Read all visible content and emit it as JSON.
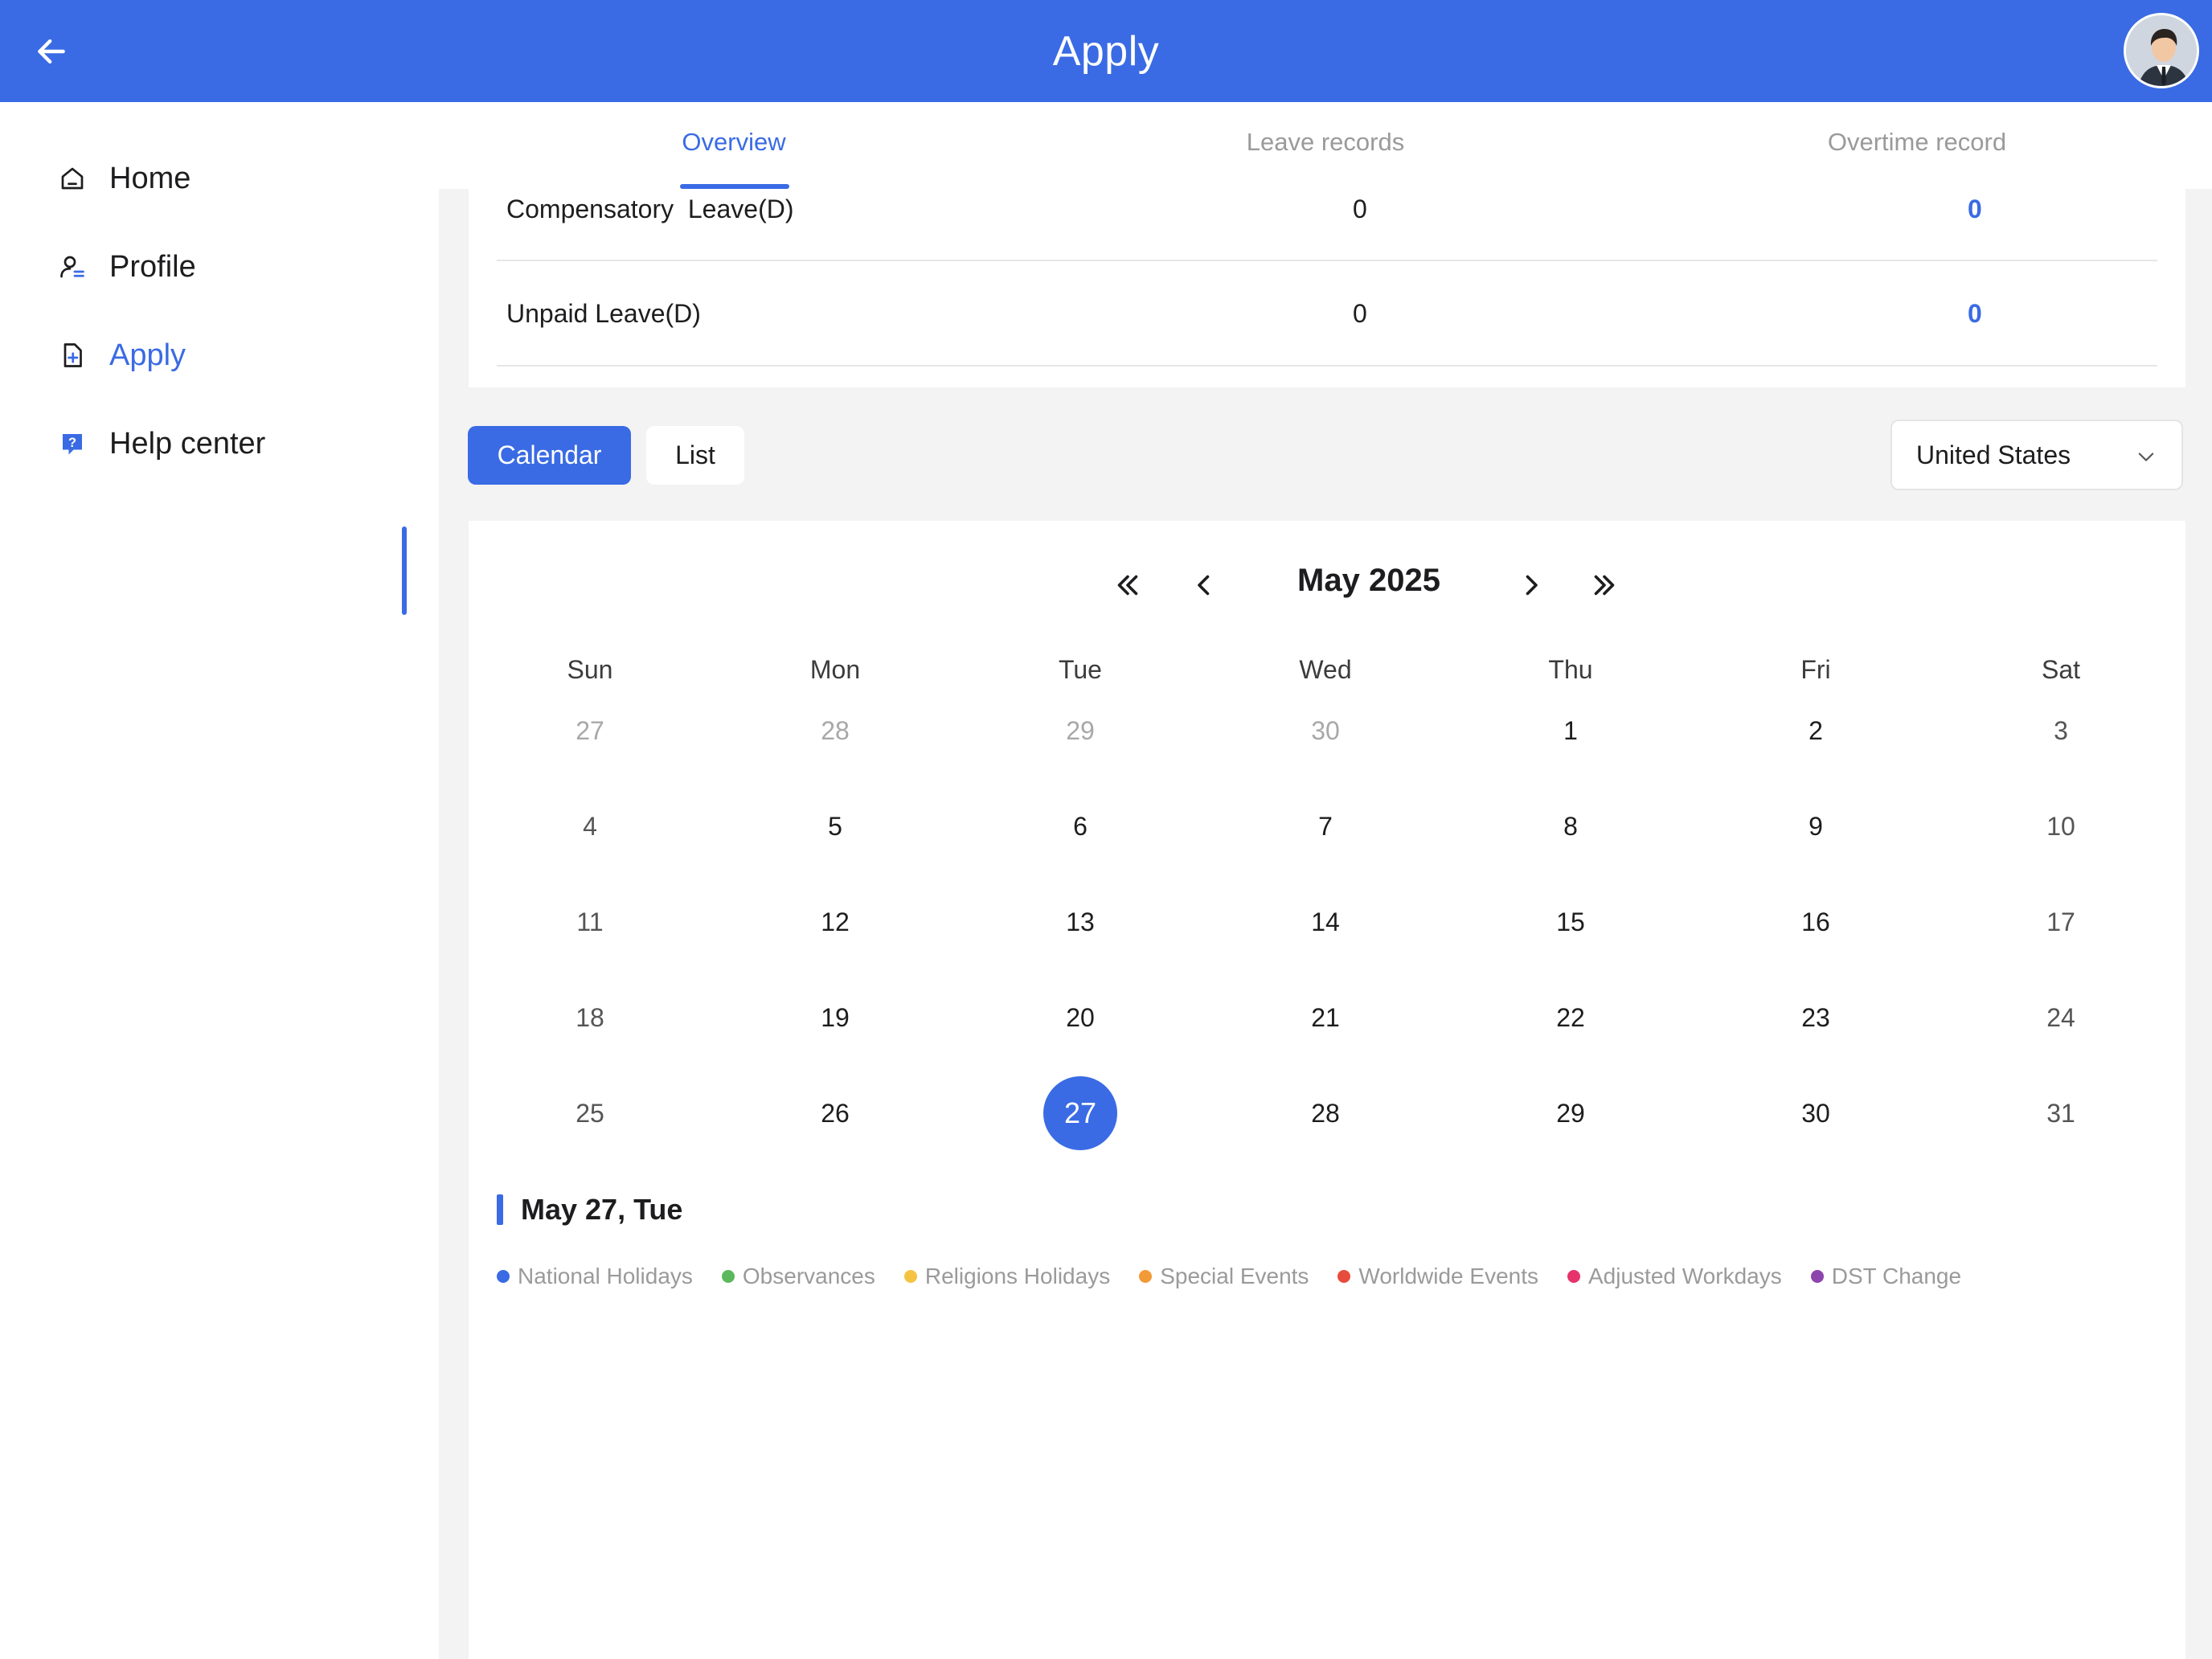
{
  "header": {
    "title": "Apply",
    "back_icon": "arrow-left-icon",
    "avatar": "user-avatar"
  },
  "tabs": [
    {
      "label": "Overview",
      "active": true
    },
    {
      "label": "Leave records",
      "active": false
    },
    {
      "label": "Overtime record",
      "active": false
    }
  ],
  "sidebar": {
    "items": [
      {
        "label": "Home",
        "icon": "home-icon",
        "active": false
      },
      {
        "label": "Profile",
        "icon": "profile-icon",
        "active": false
      },
      {
        "label": "Apply",
        "icon": "apply-document-icon",
        "active": true
      },
      {
        "label": "Help center",
        "icon": "help-icon",
        "active": false
      }
    ]
  },
  "stats": {
    "rows": [
      {
        "label": "Compensatory  Leave(D)",
        "value": "0",
        "link_value": "0"
      },
      {
        "label": "Unpaid Leave(D)",
        "value": "0",
        "link_value": "0"
      }
    ]
  },
  "view_toggle": {
    "calendar_label": "Calendar",
    "list_label": "List",
    "selected": "Calendar"
  },
  "country_select": {
    "value": "United States"
  },
  "calendar": {
    "month_title": "May 2025",
    "weekdays": [
      "Sun",
      "Mon",
      "Tue",
      "Wed",
      "Thu",
      "Fri",
      "Sat"
    ],
    "weeks": [
      [
        "27",
        "28",
        "29",
        "30",
        "1",
        "2",
        "3"
      ],
      [
        "4",
        "5",
        "6",
        "7",
        "8",
        "9",
        "10"
      ],
      [
        "11",
        "12",
        "13",
        "14",
        "15",
        "16",
        "17"
      ],
      [
        "18",
        "19",
        "20",
        "21",
        "22",
        "23",
        "24"
      ],
      [
        "25",
        "26",
        "27",
        "28",
        "29",
        "30",
        "31"
      ]
    ],
    "outside_month_first_week_count": 4,
    "selected_day": "27",
    "selected_date_label": "May 27, Tue"
  },
  "legend": [
    {
      "label": "National Holidays",
      "color": "#3a6be4"
    },
    {
      "label": "Observances",
      "color": "#5cb85c"
    },
    {
      "label": "Religions Holidays",
      "color": "#f5c342"
    },
    {
      "label": "Special Events",
      "color": "#f29a38"
    },
    {
      "label": "Worldwide Events",
      "color": "#e74c3c"
    },
    {
      "label": "Adjusted Workdays",
      "color": "#e6336b"
    },
    {
      "label": "DST Change",
      "color": "#8e44ad"
    }
  ]
}
